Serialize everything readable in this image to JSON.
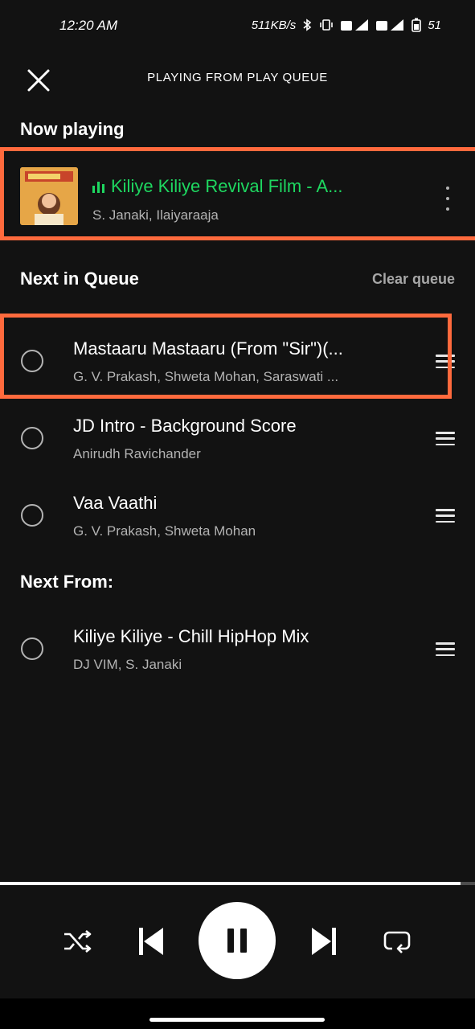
{
  "status_bar": {
    "time": "12:20 AM",
    "net_speed": "511KB/s",
    "battery": "51"
  },
  "header": {
    "title": "PLAYING FROM PLAY QUEUE"
  },
  "now_playing": {
    "section_title": "Now playing",
    "track": {
      "title": "Kiliye Kiliye Revival Film - A...",
      "artist": "S. Janaki, Ilaiyaraaja",
      "art_label": "S. JANAKI"
    }
  },
  "queue": {
    "section_title": "Next in Queue",
    "clear_label": "Clear queue",
    "items": [
      {
        "title": "Mastaaru Mastaaru (From \"Sir\")(...",
        "artist": "G. V. Prakash, Shweta Mohan, Saraswati ..."
      },
      {
        "title": "JD Intro - Background Score",
        "artist": "Anirudh Ravichander"
      },
      {
        "title": "Vaa Vaathi",
        "artist": "G. V. Prakash, Shweta Mohan"
      }
    ]
  },
  "next_from": {
    "section_title": "Next From:",
    "items": [
      {
        "title": "Kiliye Kiliye - Chill HipHop Mix",
        "artist": "DJ VIM, S. Janaki"
      }
    ]
  },
  "player": {
    "progress": 0.97
  },
  "colors": {
    "accent_green": "#1ed760",
    "highlight_orange": "#ff6a3d",
    "background": "#121212"
  }
}
